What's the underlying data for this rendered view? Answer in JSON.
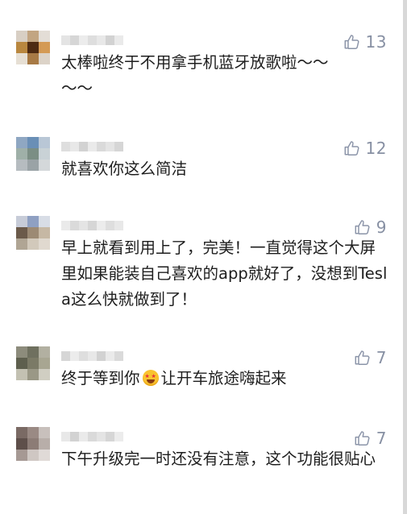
{
  "comments": [
    {
      "likes": "13",
      "text": "太棒啦终于不用拿手机蓝牙放歌啦～～\n～～",
      "avatar_colors": [
        "#d8cfc4",
        "#c2a582",
        "#e3ddd6",
        "#b9873f",
        "#4d2a12",
        "#d49a55",
        "#e6dfd4",
        "#a87a45",
        "#dcd3c8"
      ]
    },
    {
      "likes": "12",
      "text": "就喜欢你这么简洁",
      "avatar_colors": [
        "#8fa7c2",
        "#6a8fb6",
        "#b9c7d6",
        "#9fb0a8",
        "#7b8e84",
        "#c9d2d6",
        "#b6bcc0",
        "#9aa3a6",
        "#d4d8da"
      ]
    },
    {
      "likes": "9",
      "text": "早上就看到用上了，完美！一直觉得这个大屏里如果能装自己喜欢的app就好了，没想到Tesla这么快就做到了！",
      "avatar_colors": [
        "#c7ccd8",
        "#8fa0c2",
        "#d8dde6",
        "#6b5a4a",
        "#9c8a74",
        "#c6b8a4",
        "#b0a594",
        "#d2c9bb",
        "#e0d9cf"
      ]
    },
    {
      "likes": "7",
      "text_before": "终于等到你",
      "emoji_name": "star-struck-emoji",
      "text_after": "让开车旅途嗨起来",
      "avatar_colors": [
        "#8d8c7c",
        "#6f705f",
        "#b2b0a1",
        "#5e5f4e",
        "#7b7a66",
        "#a8a692",
        "#c3c1b2",
        "#9a9886",
        "#d0cec2"
      ]
    },
    {
      "likes": "7",
      "text": "下午升级完一时还没有注意，这个功能很贴心",
      "avatar_colors": [
        "#7a6a64",
        "#9a8a84",
        "#c8c0bc",
        "#5e4f4a",
        "#8c7c76",
        "#b8aea9",
        "#a69994",
        "#cfc7c3",
        "#e0dad7"
      ]
    }
  ],
  "like_icon": "thumbs-up-icon"
}
